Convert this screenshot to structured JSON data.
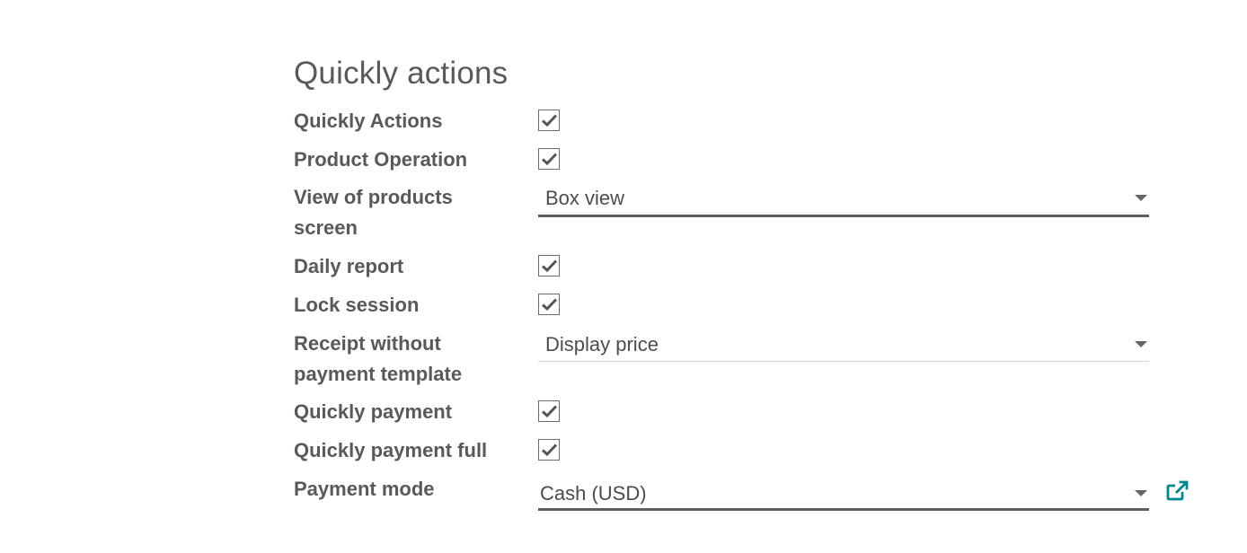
{
  "section": {
    "title": "Quickly actions"
  },
  "fields": {
    "quickly_actions": {
      "label": "Quickly Actions",
      "checked": true
    },
    "product_operation": {
      "label": "Product Operation",
      "checked": true
    },
    "view_of_products_screen": {
      "label": "View of products screen",
      "value": "Box view"
    },
    "daily_report": {
      "label": "Daily report",
      "checked": true
    },
    "lock_session": {
      "label": "Lock session",
      "checked": true
    },
    "receipt_without_payment_template": {
      "label": "Receipt without payment template",
      "value": "Display price"
    },
    "quickly_payment": {
      "label": "Quickly payment",
      "checked": true
    },
    "quickly_payment_full": {
      "label": "Quickly payment full",
      "checked": true
    },
    "payment_mode": {
      "label": "Payment mode",
      "value": "Cash (USD)",
      "link_icon": "external-link-icon"
    }
  },
  "colors": {
    "text": "#595959",
    "link": "#00868a",
    "underline_strong": "#5e5e5e",
    "underline_light": "#d0d0d0"
  }
}
